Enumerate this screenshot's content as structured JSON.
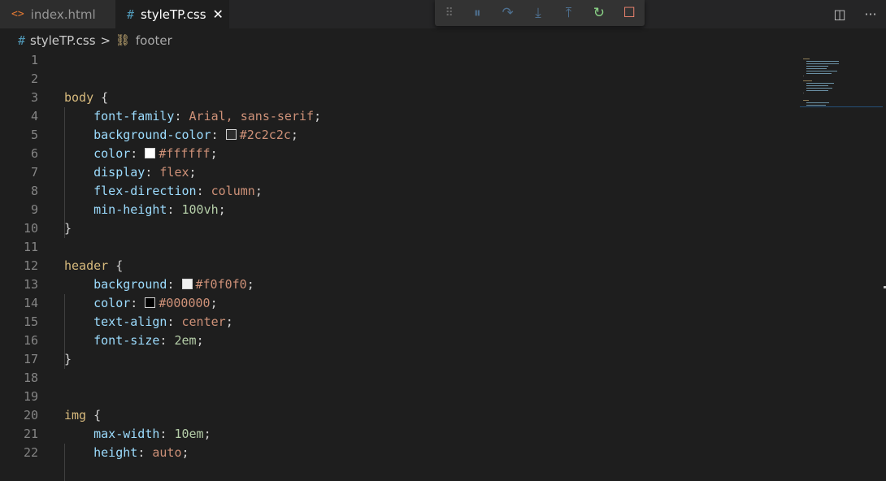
{
  "tabs": [
    {
      "label": "index.html",
      "icon": "html-code-icon",
      "icon_glyph": "<>",
      "active": false
    },
    {
      "label": "styleTP.css",
      "icon": "css-hash-icon",
      "icon_glyph": "#",
      "active": true,
      "close_glyph": "✕"
    }
  ],
  "header_actions": {
    "split_glyph": "◫",
    "more_glyph": "···"
  },
  "debug_toolbar": {
    "grip": "⠿",
    "pause": "⏸",
    "step_over": "↷",
    "step_into": "⤓",
    "step_out": "⤒",
    "restart": "↻",
    "stop": "☐"
  },
  "breadcrumb": {
    "hash": "#",
    "file": "styleTP.css",
    "separator": ">",
    "symbol_icon": "⛓",
    "symbol": "footer"
  },
  "colors": {
    "editor_bg": "#1e1e1e",
    "tabbar_bg": "#252526",
    "selector": "#d7ba7d",
    "property": "#9cdcfe",
    "string_value": "#ce9178",
    "number_value": "#b5cea8",
    "line_number": "#858585"
  },
  "code": [
    {
      "n": "1"
    },
    {
      "n": "2"
    },
    {
      "n": "3",
      "sel": "body",
      "brace": " {"
    },
    {
      "n": "4",
      "prop": "font-family",
      "val": "Arial, sans-serif"
    },
    {
      "n": "5",
      "prop": "background-color",
      "swatch": "#2c2c2c",
      "val": "#2c2c2c"
    },
    {
      "n": "6",
      "prop": "color",
      "swatch": "#ffffff",
      "val": "#ffffff"
    },
    {
      "n": "7",
      "prop": "display",
      "val": "flex"
    },
    {
      "n": "8",
      "prop": "flex-direction",
      "val": "column"
    },
    {
      "n": "9",
      "prop": "min-height",
      "num": "100vh"
    },
    {
      "n": "10",
      "close": "}"
    },
    {
      "n": "11"
    },
    {
      "n": "12",
      "sel": "header",
      "brace": " {"
    },
    {
      "n": "13",
      "prop": "background",
      "swatch": "#f0f0f0",
      "val": "#f0f0f0"
    },
    {
      "n": "14",
      "prop": "color",
      "swatch": "#000000",
      "val": "#000000"
    },
    {
      "n": "15",
      "prop": "text-align",
      "val": "center"
    },
    {
      "n": "16",
      "prop": "font-size",
      "num": "2em"
    },
    {
      "n": "17",
      "close": "}"
    },
    {
      "n": "18"
    },
    {
      "n": "19"
    },
    {
      "n": "20",
      "sel": "img",
      "brace": " {"
    },
    {
      "n": "21",
      "prop": "max-width",
      "num": "10em"
    },
    {
      "n": "22",
      "prop": "height",
      "val": "auto"
    }
  ]
}
